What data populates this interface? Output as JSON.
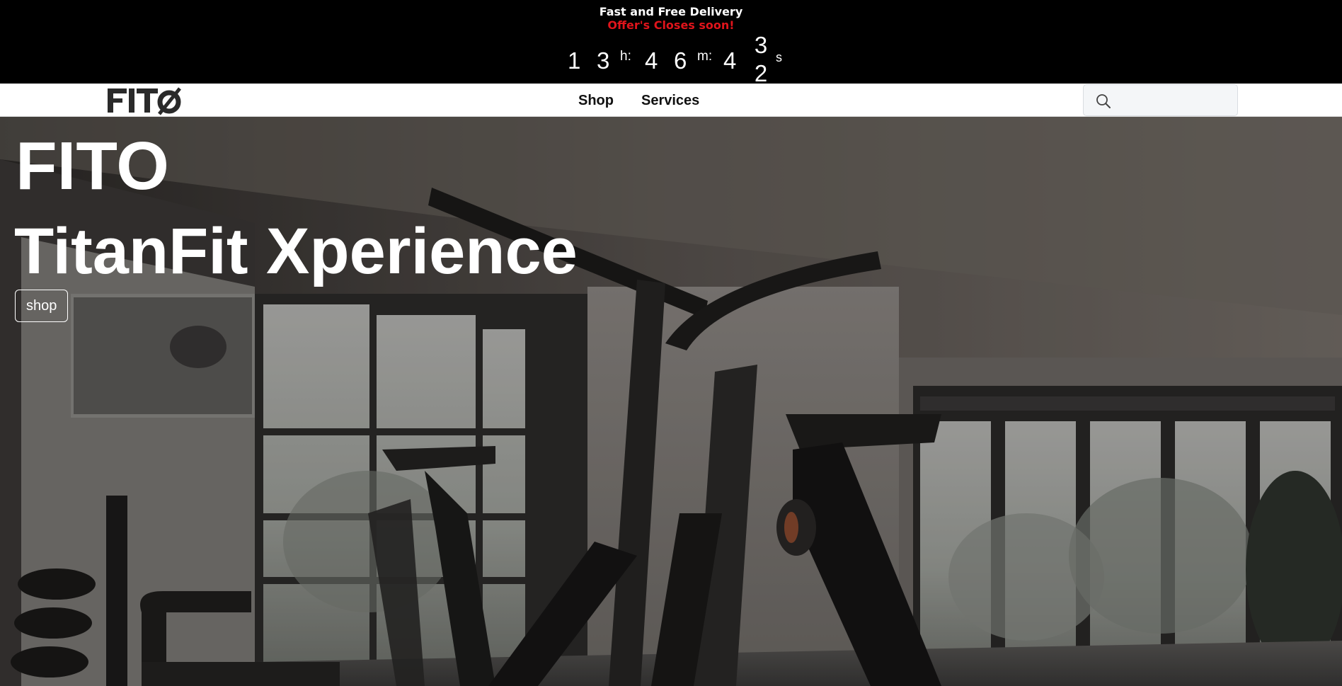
{
  "promo": {
    "title": "Fast and Free Delivery",
    "subtitle": "Offer's Closes soon!",
    "subtitle_color": "#e0141b",
    "countdown": {
      "hours": [
        "1",
        "3"
      ],
      "hours_unit": "h:",
      "minutes": [
        "4",
        "6"
      ],
      "minutes_unit": "m:",
      "seconds_static": "4",
      "seconds_roll": [
        "3",
        "2"
      ],
      "seconds_unit": "s"
    }
  },
  "nav": {
    "logo_text": "FITO",
    "links": [
      {
        "label": "Shop"
      },
      {
        "label": "Services"
      }
    ],
    "search": {
      "placeholder": "",
      "icon": "search-icon"
    }
  },
  "hero": {
    "title": "FITO",
    "subtitle": "TitanFit Xperience",
    "button_label": "shop",
    "background": "gym-interior-photo"
  }
}
